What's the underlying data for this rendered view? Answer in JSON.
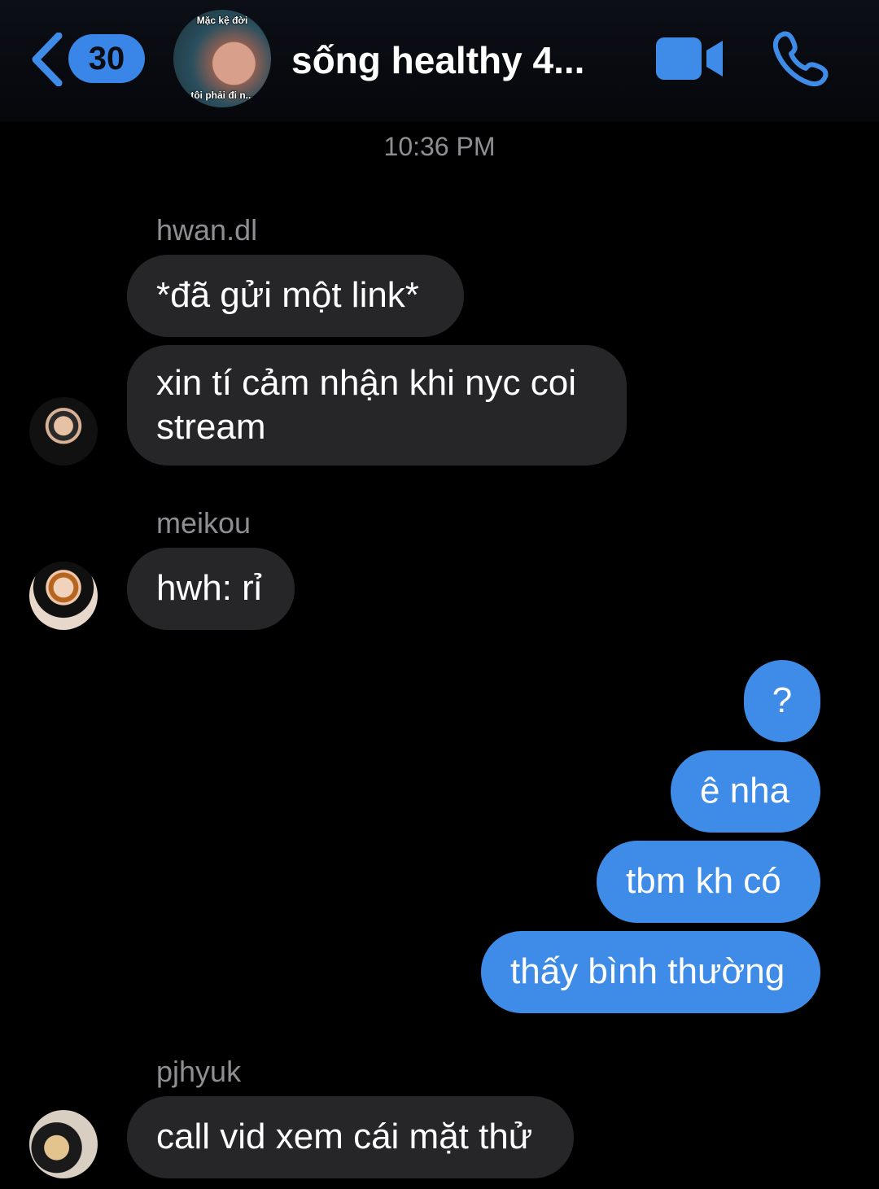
{
  "header": {
    "unread_count": "30",
    "group_name": "sống healthy 4...",
    "group_avatar_caption_top": "Mặc kệ đời",
    "group_avatar_caption_bottom": "tôi phải đi n..."
  },
  "colors": {
    "accent": "#3f8ce8",
    "incoming_bubble": "#262628",
    "background": "#000000",
    "secondary_text": "#8e8e93"
  },
  "conversation": {
    "timestamp": "10:36 PM",
    "messages": [
      {
        "sender": "hwan.dl",
        "text": "*đã gửi một link*",
        "direction": "incoming"
      },
      {
        "sender": "hwan.dl",
        "text": "xin tí cảm nhận khi nyc coi stream",
        "direction": "incoming"
      },
      {
        "sender": "meikou",
        "text": "hwh: rỉ",
        "direction": "incoming"
      },
      {
        "sender": "me",
        "text": "?",
        "direction": "outgoing"
      },
      {
        "sender": "me",
        "text": "ê nha",
        "direction": "outgoing"
      },
      {
        "sender": "me",
        "text": "tbm kh có",
        "direction": "outgoing"
      },
      {
        "sender": "me",
        "text": "thấy bình thường",
        "direction": "outgoing"
      },
      {
        "sender": "pjhyuk",
        "text": "call vid xem cái mặt thử",
        "direction": "incoming"
      }
    ]
  },
  "icons": {
    "back": "chevron-left-icon",
    "video": "video-camera-icon",
    "phone": "phone-icon"
  }
}
